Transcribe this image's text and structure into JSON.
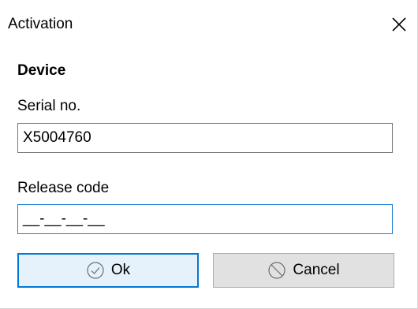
{
  "window": {
    "title": "Activation",
    "close_icon": "close-icon"
  },
  "device": {
    "section_title": "Device",
    "serial_label": "Serial no.",
    "serial_value": "X5004760",
    "release_label": "Release code",
    "release_value": "__-__-__-__"
  },
  "buttons": {
    "ok_label": "Ok",
    "ok_icon": "check-circle-icon",
    "cancel_label": "Cancel",
    "cancel_icon": "prohibited-icon"
  },
  "colors": {
    "focus_border": "#0078d7",
    "button_bg": "#e1e1e1",
    "default_button_bg": "#e5f1fb"
  }
}
